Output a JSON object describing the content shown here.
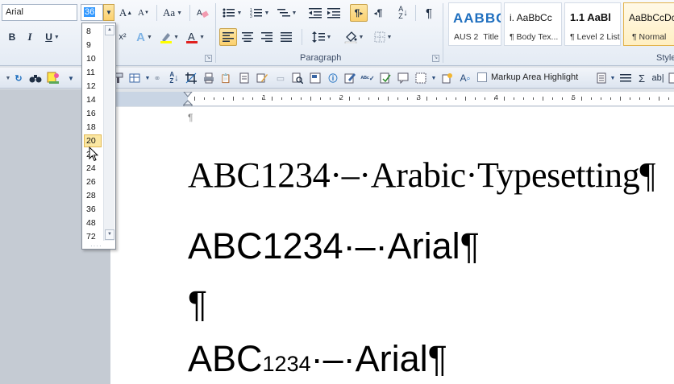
{
  "ribbon": {
    "font_name": "Arial",
    "font_size": "36",
    "paragraph_label": "Paragraph",
    "styles_label": "Styles",
    "styles": [
      {
        "sample": "AABBC",
        "name": "AUS 2",
        "name2": "Title"
      },
      {
        "sample": "i.  AaBbCc",
        "name": "¶ Body Tex..."
      },
      {
        "sample": "1.1  AaBl",
        "name": "¶ Level 2 List"
      },
      {
        "sample": "AaBbCcDc",
        "name": "¶ Normal"
      }
    ]
  },
  "toolbar": {
    "markup_area_highlight": "Markup Area Highlight"
  },
  "ruler": {
    "numbers": [
      "1",
      "2",
      "3",
      "4",
      "5"
    ]
  },
  "font_size_list": {
    "options": [
      "8",
      "9",
      "10",
      "11",
      "12",
      "14",
      "16",
      "18",
      "20",
      "22",
      "24",
      "26",
      "28",
      "36",
      "48",
      "72"
    ],
    "highlighted": "20"
  },
  "document": {
    "pilcrow": "¶",
    "line1": "ABC1234·–·Arabic·Typesetting¶",
    "line2": "ABC1234·–·Arial¶",
    "line3": "¶",
    "line4_a": "ABC",
    "line4_sub": "1234",
    "line4_b": "·–·Arial¶"
  }
}
